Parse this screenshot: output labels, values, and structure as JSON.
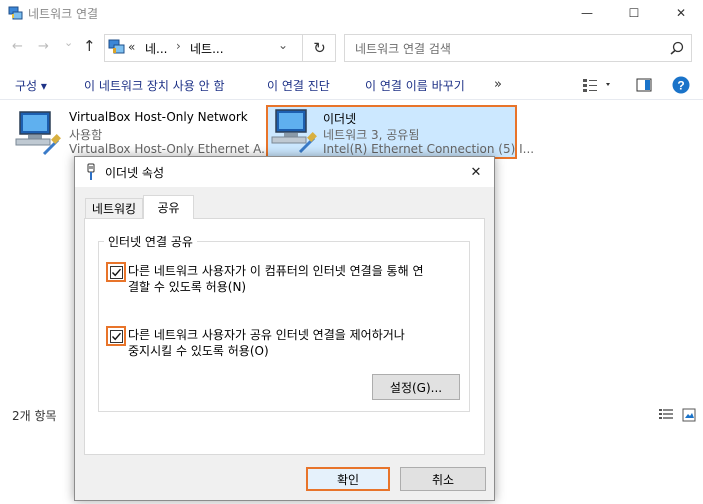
{
  "window": {
    "title": "네트워크 연결",
    "minimize": "—",
    "maximize": "☐",
    "close": "✕"
  },
  "navigation": {
    "back": "←",
    "forward": "→",
    "history": "⌄",
    "up": "↑",
    "breadcrumb": {
      "overflow": "«",
      "segment1": "네...",
      "sep": "›",
      "segment2": "네트..."
    },
    "refresh": "↻",
    "dropdown": "⌄"
  },
  "search": {
    "placeholder": "네트워크 연결 검색"
  },
  "command_bar": {
    "organize": "구성 ▾",
    "disable": "이 네트워크 장치 사용 안 함",
    "diagnose": "이 연결 진단",
    "rename": "이 연결 이름 바꾸기",
    "more": "»"
  },
  "items": [
    {
      "name": "VirtualBox Host-Only Network",
      "status": "사용함",
      "device": "VirtualBox Host-Only Ethernet A..."
    },
    {
      "name": "이더넷",
      "status": "네트워크 3, 공유됨",
      "device": "Intel(R) Ethernet Connection (5) I..."
    }
  ],
  "status_bar": {
    "count": "2개 항목"
  },
  "dialog": {
    "title": "이더넷 속성",
    "close": "✕",
    "tabs": {
      "networking": "네트워킹",
      "sharing": "공유"
    },
    "group_title": "인터넷 연결 공유",
    "option1": {
      "line1": "다른 네트워크 사용자가 이 컴퓨터의 인터넷 연결을 통해 연",
      "line2": "결할 수 있도록 허용(N)"
    },
    "option2": {
      "line1": "다른 네트워크 사용자가 공유 인터넷 연결을 제어하거나",
      "line2": "중지시킬 수 있도록 허용(O)"
    },
    "settings": "설정(G)...",
    "ok": "확인",
    "cancel": "취소"
  },
  "colors": {
    "highlight": "#e8742a",
    "selection": "#cce8ff",
    "command_text": "#1e3287",
    "help": "#1a73c9"
  }
}
